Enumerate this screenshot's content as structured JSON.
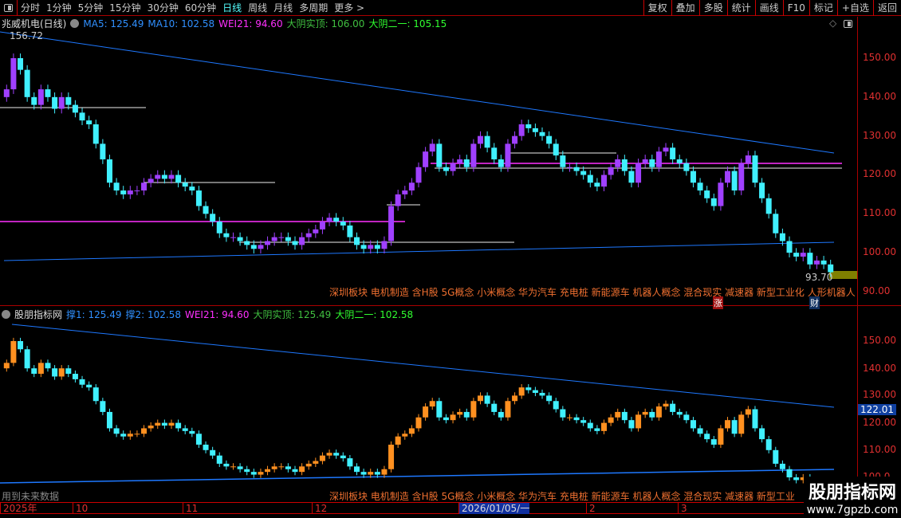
{
  "toolbar": {
    "periods": [
      "分时",
      "1分钟",
      "5分钟",
      "15分钟",
      "30分钟",
      "60分钟",
      "日线",
      "周线",
      "月线",
      "多周期",
      "更多 >"
    ],
    "active": "日线",
    "tools": [
      "复权",
      "叠加",
      "多股",
      "统计",
      "画线",
      "F10",
      "标记",
      "+自选",
      "返回"
    ]
  },
  "main": {
    "title": "兆威机电(日线)",
    "ma5": "MA5: 125.49",
    "ma10": "MA10: 102.58",
    "wei21": "WEI21: 94.60",
    "dyss": "大阴实顶: 106.00",
    "dyey": "大阴二一: 105.15",
    "high_label": "156.72",
    "low_label": "93.70",
    "yticks": [
      "150.00",
      "140.00",
      "130.00",
      "120.00",
      "110.00",
      "100.00",
      "90.00"
    ],
    "concepts": "深圳板块 电机制造 含H股 5G概念 小米概念 华为汽车 充电桩 新能源车 机器人概念 混合现实 减速器 新型工业化 人形机器人",
    "badge_zhang": "涨",
    "badge_cai": "财"
  },
  "sub": {
    "title": "股朋指标网",
    "c1": "撑1: 125.49",
    "c2": "撑2: 102.58",
    "wei21": "WEI21: 94.60",
    "dyss": "大阴实顶: 125.49",
    "dyey": "大阴二一: 102.58",
    "yticks": [
      "150.00",
      "140.00",
      "130.00",
      "120.00",
      "110.00",
      "100.0"
    ],
    "price_tag": "122.01",
    "future_note": "用到未来数据",
    "concepts": "深圳板块 电机制造 含H股 5G概念 小米概念 华为汽车 充电桩 新能源车 机器人概念 混合现实 减速器 新型工业"
  },
  "timeline": {
    "labels": [
      "2025年",
      "10",
      "11",
      "12",
      "2026/01/05/一",
      "2",
      "3"
    ]
  },
  "watermark": {
    "name": "股朋指标网",
    "url": "www.7gpzb.com"
  },
  "colors": {
    "up_main": "#a040ff",
    "down_main": "#40f0ff",
    "up_sub": "#ff9020",
    "trend": "#1e78ff",
    "support": "#ff30ff"
  },
  "chart_data": {
    "type": "candlestick",
    "ylim_main": [
      88,
      158
    ],
    "ylim_sub": [
      98,
      160
    ],
    "closes": [
      142,
      150,
      147,
      140,
      138,
      142,
      140,
      137,
      140,
      138,
      136,
      134,
      133,
      128,
      124,
      118,
      116,
      115,
      116,
      116,
      118,
      119,
      120,
      119,
      120,
      118,
      117,
      116,
      112,
      110,
      108,
      105,
      104,
      104,
      103,
      102,
      101,
      102,
      103,
      104,
      104,
      103,
      102,
      104,
      105,
      106,
      108,
      109,
      108,
      107,
      104,
      102,
      101,
      102,
      101,
      103,
      112,
      115,
      116,
      118,
      122,
      126,
      128,
      122,
      121,
      123,
      124,
      122,
      128,
      130,
      127,
      124,
      122,
      128,
      130,
      133,
      132,
      131,
      130,
      128,
      125,
      122,
      122,
      121,
      120,
      118,
      117,
      120,
      122,
      124,
      121,
      118,
      123,
      124,
      122,
      126,
      127,
      124,
      123,
      121,
      118,
      116,
      114,
      112,
      118,
      121,
      116,
      123,
      125,
      118,
      114,
      110,
      105,
      103,
      100,
      99,
      100,
      97,
      98,
      97,
      95
    ]
  }
}
